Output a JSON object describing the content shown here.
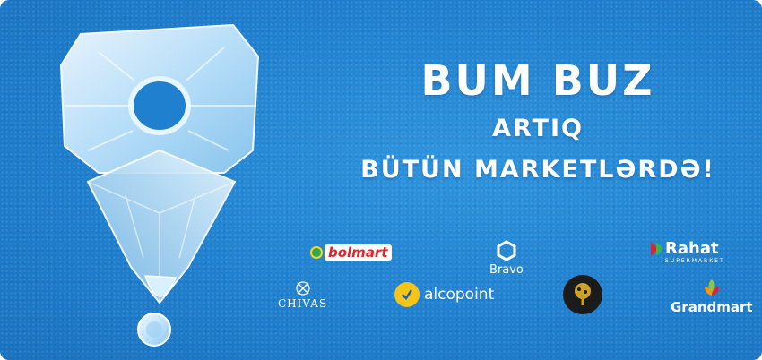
{
  "banner": {
    "title": "BUM BUZ",
    "subtitle_line1": "ARTIQ",
    "subtitle_line2": "BÜTÜN MARKETLƏRDƏ!"
  },
  "logos": {
    "bolmart": {
      "text": "bolmart",
      "icon": "bolmart-logo-icon"
    },
    "bravo": {
      "text": "Bravo",
      "icon": "bravo-hexagon-icon"
    },
    "rahat": {
      "text": "Rahat",
      "subtext": "SUPERMARKET",
      "icon": "rahat-arrow-icon"
    },
    "chivas": {
      "text": "CHIVAS",
      "icon": "chivas-crest-icon"
    },
    "alcopoint": {
      "text": "alcopoint",
      "icon": "alcopoint-check-icon"
    },
    "tree": {
      "icon": "tree-logo-icon"
    },
    "grandmart": {
      "text": "Grandmart",
      "icon": "grandmart-leaf-icon"
    }
  },
  "colors": {
    "background": "#1f80cf",
    "text": "#ffffff",
    "bolmart_red": "#e3232a",
    "alcopoint_yellow": "#f4c419"
  }
}
